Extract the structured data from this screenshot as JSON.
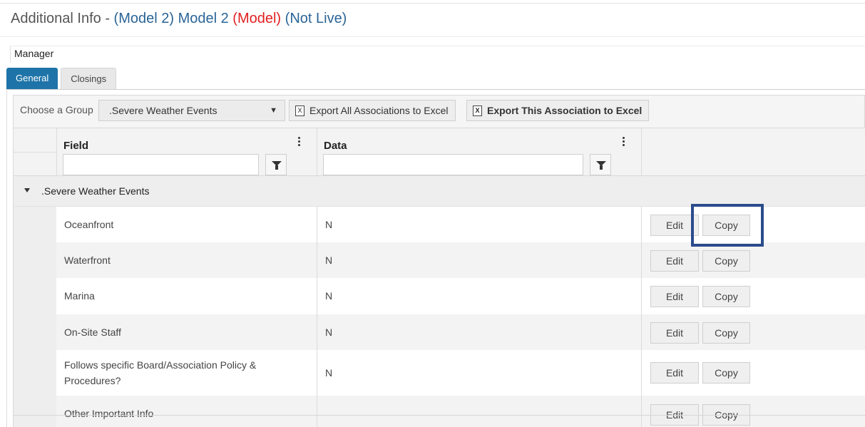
{
  "title": {
    "base": "Additional Info - ",
    "part1": "(Model 2)",
    "part2": "Model 2",
    "part3": "(Model)",
    "part4": "(Not Live)"
  },
  "manager_label": "Manager",
  "tabs": [
    {
      "label": "General",
      "active": true
    },
    {
      "label": "Closings",
      "active": false
    }
  ],
  "toolbar": {
    "group_label": "Choose a Group",
    "group_selected": ".Severe Weather Events",
    "export_all_label": "Export All Associations to Excel",
    "export_this_label": "Export This Association to Excel",
    "excel_icon_glyph": "X"
  },
  "grid": {
    "columns": [
      {
        "header": "Field"
      },
      {
        "header": "Data"
      }
    ],
    "group_name": ".Severe Weather Events",
    "edit_label": "Edit",
    "copy_label": "Copy",
    "rows": [
      {
        "field": "Oceanfront",
        "data": "N"
      },
      {
        "field": "Waterfront",
        "data": "N"
      },
      {
        "field": "Marina",
        "data": "N"
      },
      {
        "field": "On-Site Staff",
        "data": "N"
      },
      {
        "field": "Follows specific Board/Association Policy & Procedures?",
        "data": "N"
      },
      {
        "field": "Other Important Info",
        "data": ""
      }
    ]
  },
  "colors": {
    "tab_active": "#1e74a8",
    "title_blue": "#2a6496",
    "title_red": "#e02020",
    "highlight": "#2b4c8c"
  }
}
